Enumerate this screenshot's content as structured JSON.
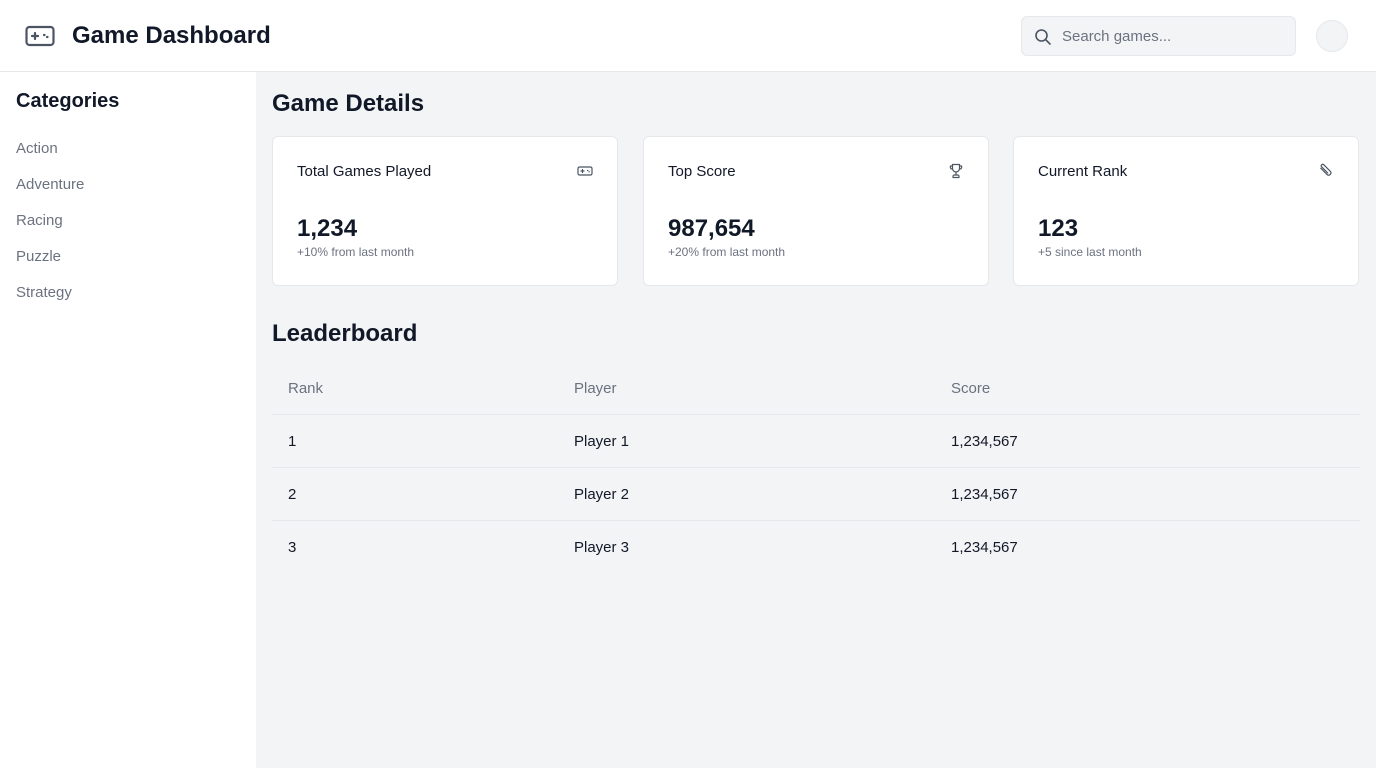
{
  "header": {
    "title": "Game Dashboard",
    "logo_icon": "gamepad-icon",
    "search_placeholder": "Search games...",
    "search_value": ""
  },
  "sidebar": {
    "title": "Categories",
    "items": [
      {
        "label": "Action"
      },
      {
        "label": "Adventure"
      },
      {
        "label": "Racing"
      },
      {
        "label": "Puzzle"
      },
      {
        "label": "Strategy"
      }
    ]
  },
  "game_details": {
    "title": "Game Details",
    "cards": [
      {
        "title": "Total Games Played",
        "icon": "gamepad-icon",
        "value": "1,234",
        "sub": "+10% from last month"
      },
      {
        "title": "Top Score",
        "icon": "trophy-icon",
        "value": "987,654",
        "sub": "+20% from last month"
      },
      {
        "title": "Current Rank",
        "icon": "paperclip-icon",
        "value": "123",
        "sub": "+5 since last month"
      }
    ]
  },
  "leaderboard": {
    "title": "Leaderboard",
    "columns": [
      "Rank",
      "Player",
      "Score"
    ],
    "rows": [
      [
        "1",
        "Player 1",
        "1,234,567"
      ],
      [
        "2",
        "Player 2",
        "1,234,567"
      ],
      [
        "3",
        "Player 3",
        "1,234,567"
      ]
    ]
  },
  "colors": {
    "background": "#f3f4f6",
    "surface": "#ffffff",
    "border": "#e5e7eb",
    "text": "#111827",
    "muted": "#6b7280"
  }
}
